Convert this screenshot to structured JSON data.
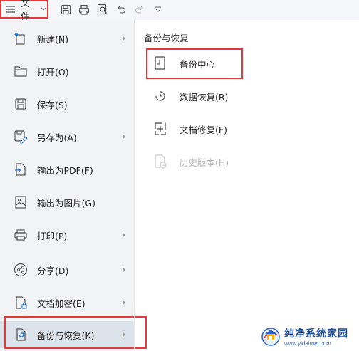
{
  "toolbar": {
    "file_label": "文件",
    "icons": [
      "save-icon",
      "print-icon",
      "print-preview-icon",
      "undo-icon",
      "redo-icon",
      "more-dropdown-icon"
    ]
  },
  "menu": {
    "items": [
      {
        "label": "新建(N)",
        "icon": "new-document-icon",
        "has_arrow": true
      },
      {
        "label": "打开(O)",
        "icon": "folder-open-icon",
        "has_arrow": false
      },
      {
        "label": "保存(S)",
        "icon": "save-icon",
        "has_arrow": false
      },
      {
        "label": "另存为(A)",
        "icon": "save-as-icon",
        "has_arrow": true
      },
      {
        "label": "输出为PDF(F)",
        "icon": "export-pdf-icon",
        "has_arrow": false
      },
      {
        "label": "输出为图片(G)",
        "icon": "export-image-icon",
        "has_arrow": false
      },
      {
        "label": "打印(P)",
        "icon": "print-icon",
        "has_arrow": true
      },
      {
        "label": "分享(D)",
        "icon": "share-icon",
        "has_arrow": true
      },
      {
        "label": "文档加密(E)",
        "icon": "document-lock-icon",
        "has_arrow": true
      },
      {
        "label": "备份与恢复(K)",
        "icon": "backup-restore-icon",
        "has_arrow": true,
        "selected": true
      }
    ]
  },
  "panel": {
    "title": "备份与恢复",
    "items": [
      {
        "label": "备份中心",
        "icon": "backup-center-icon",
        "enabled": true
      },
      {
        "label": "数据恢复(R)",
        "icon": "data-recovery-icon",
        "enabled": true
      },
      {
        "label": "文档修复(F)",
        "icon": "document-repair-icon",
        "enabled": true
      },
      {
        "label": "历史版本(H)",
        "icon": "history-version-icon",
        "enabled": false
      }
    ]
  },
  "watermark": {
    "title": "纯净系统家园",
    "url": "www.yidaimei.com"
  },
  "colors": {
    "menu_bg": "#f2f3f5",
    "selected_bg": "#dde3ea",
    "highlight": "#e03a3a",
    "disabled_text": "#b4b4b4"
  }
}
